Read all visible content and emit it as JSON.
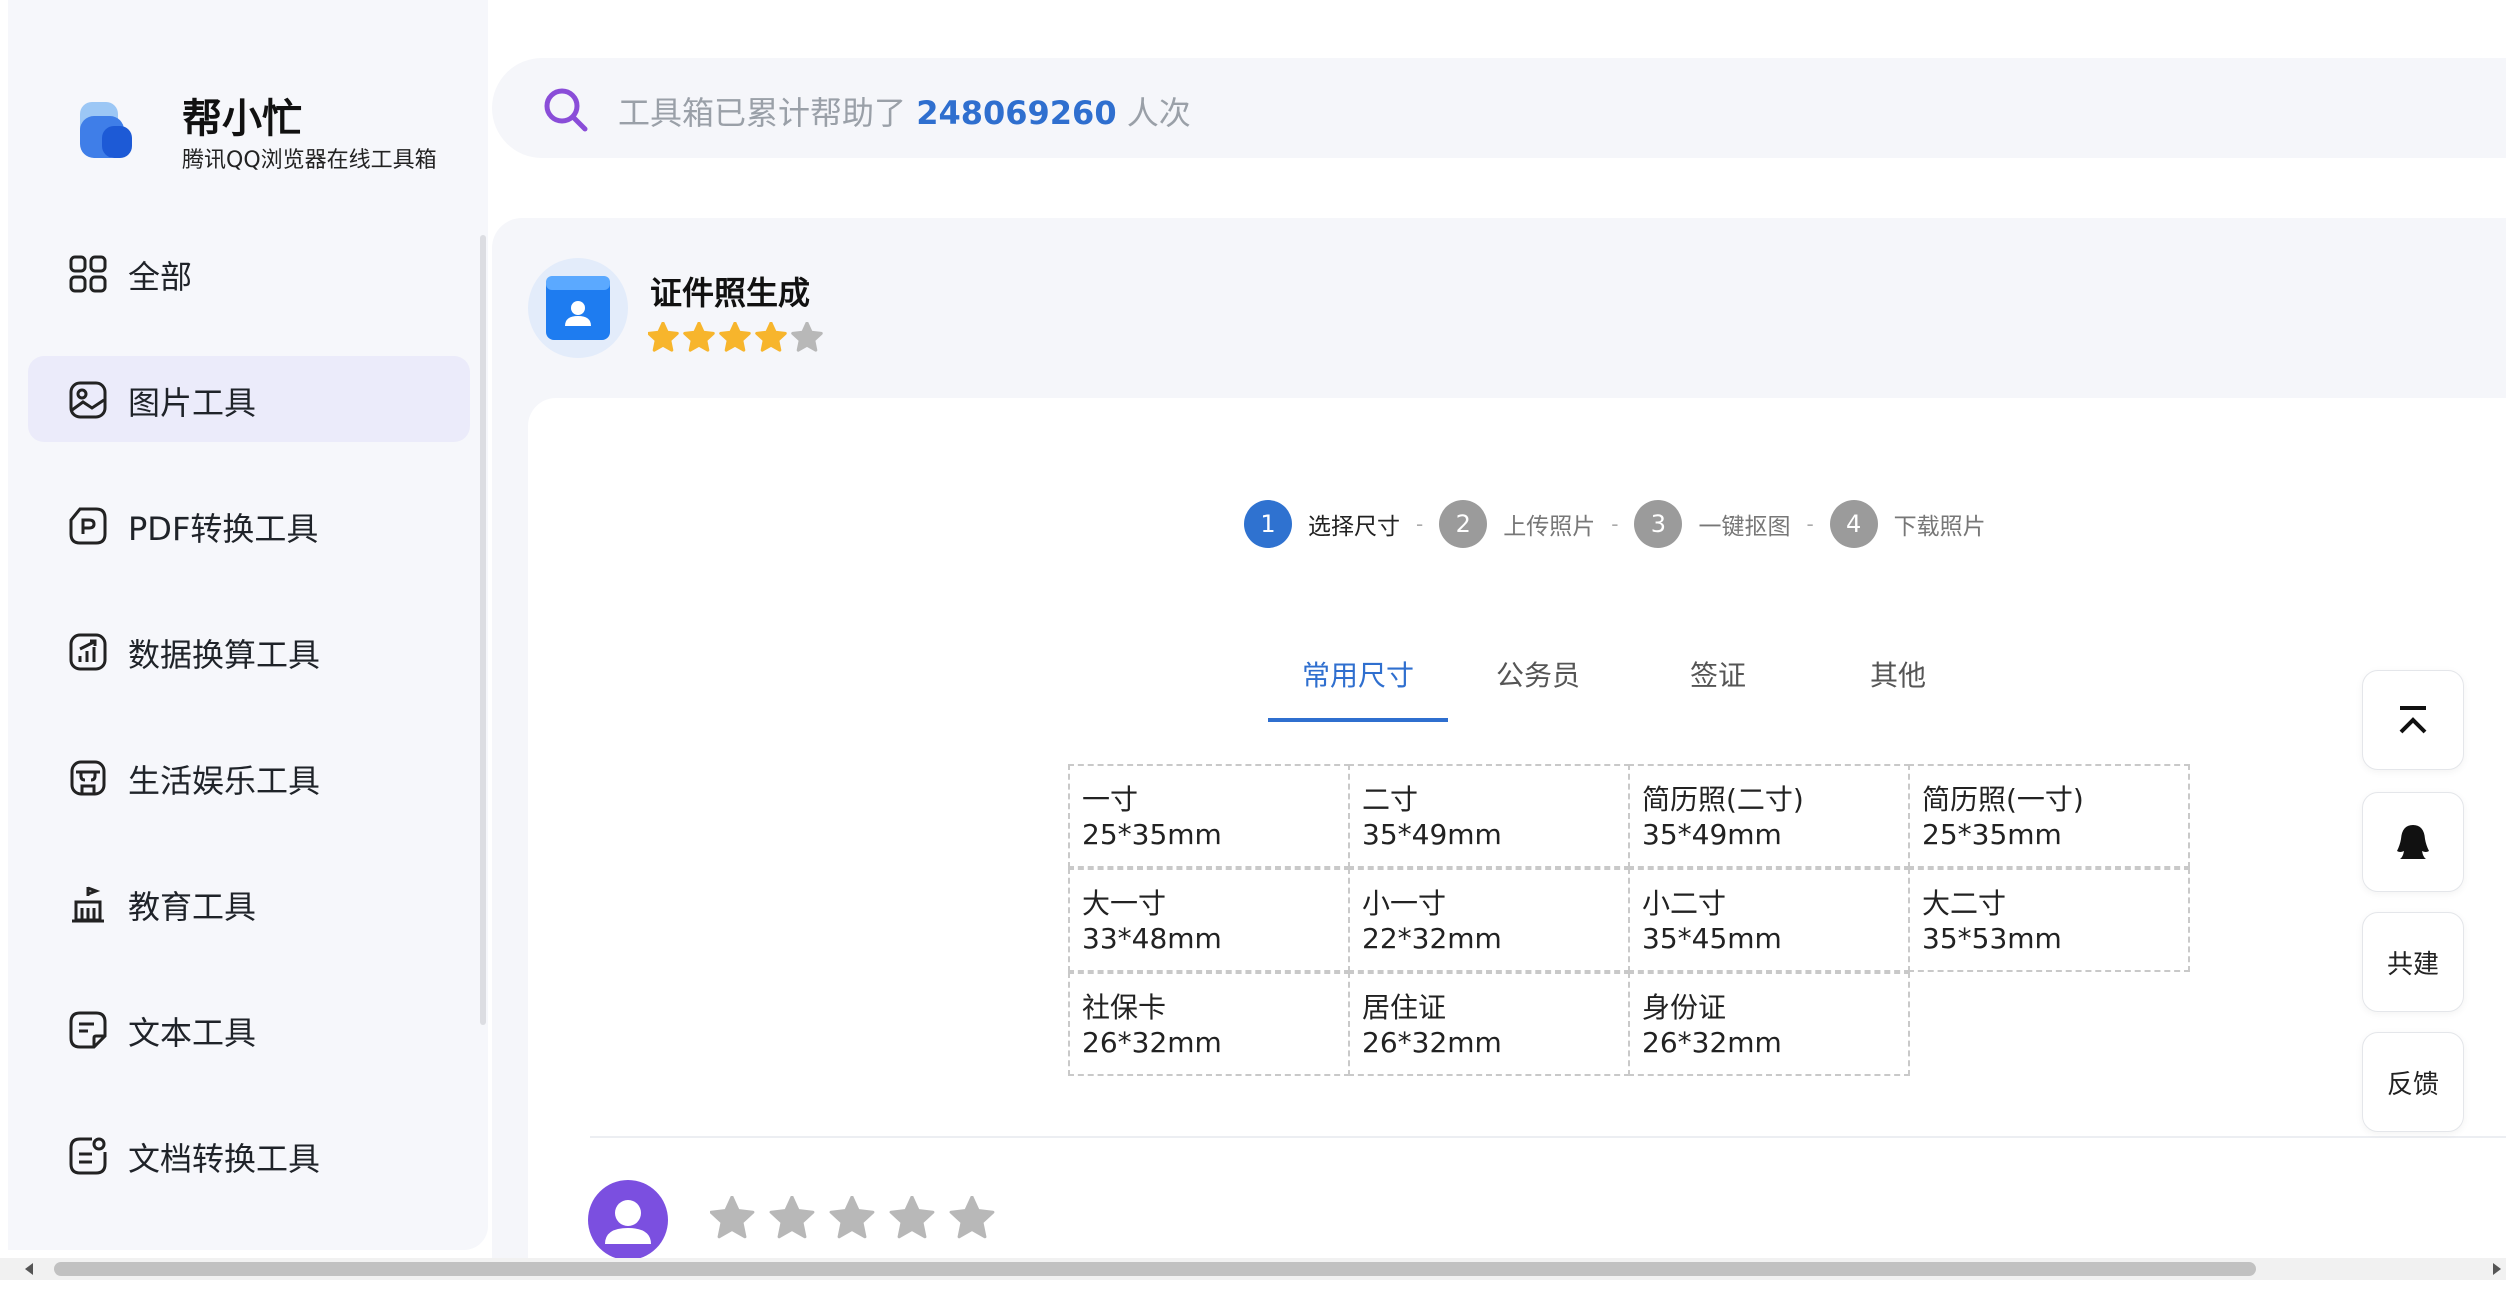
{
  "brand": {
    "name": "帮小忙",
    "subtitle": "腾讯QQ浏览器在线工具箱"
  },
  "sidebar": {
    "items": [
      {
        "label": "全部",
        "icon": "grid-icon",
        "active": false
      },
      {
        "label": "图片工具",
        "icon": "image-icon",
        "active": true
      },
      {
        "label": "PDF转换工具",
        "icon": "pdf-icon",
        "active": false
      },
      {
        "label": "数据换算工具",
        "icon": "chart-icon",
        "active": false
      },
      {
        "label": "生活娱乐工具",
        "icon": "shop-icon",
        "active": false
      },
      {
        "label": "教育工具",
        "icon": "school-icon",
        "active": false
      },
      {
        "label": "文本工具",
        "icon": "text-doc-icon",
        "active": false
      },
      {
        "label": "文档转换工具",
        "icon": "doc-convert-icon",
        "active": false
      }
    ]
  },
  "search": {
    "prefix": "工具箱已累计帮助了",
    "count": "248069260",
    "suffix": "人次"
  },
  "tool": {
    "title": "证件照生成",
    "rating": 4,
    "rating_max": 5
  },
  "steps": [
    {
      "num": "1",
      "label": "选择尺寸",
      "active": true
    },
    {
      "num": "2",
      "label": "上传照片",
      "active": false
    },
    {
      "num": "3",
      "label": "一键抠图",
      "active": false
    },
    {
      "num": "4",
      "label": "下载照片",
      "active": false
    }
  ],
  "tabs": [
    {
      "label": "常用尺寸",
      "active": true
    },
    {
      "label": "公务员",
      "active": false
    },
    {
      "label": "签证",
      "active": false
    },
    {
      "label": "其他",
      "active": false
    }
  ],
  "sizes": [
    {
      "name": "一寸",
      "size": "25*35mm"
    },
    {
      "name": "二寸",
      "size": "35*49mm"
    },
    {
      "name": "简历照(二寸)",
      "size": "35*49mm"
    },
    {
      "name": "简历照(一寸)",
      "size": "25*35mm"
    },
    {
      "name": "大一寸",
      "size": "33*48mm"
    },
    {
      "name": "小一寸",
      "size": "22*32mm"
    },
    {
      "name": "小二寸",
      "size": "35*45mm"
    },
    {
      "name": "大二寸",
      "size": "35*53mm"
    },
    {
      "name": "社保卡",
      "size": "26*32mm"
    },
    {
      "name": "居住证",
      "size": "26*32mm"
    },
    {
      "name": "身份证",
      "size": "26*32mm"
    }
  ],
  "floating": {
    "top_icon": "back-to-top-icon",
    "qq_icon": "qq-penguin-icon",
    "cobuild": "共建",
    "feedback": "反馈"
  },
  "user_rating": {
    "rating": 0,
    "rating_max": 5
  },
  "colors": {
    "accent": "#2f6fcf",
    "active_nav_bg": "#ebebfa",
    "star_on": "#f7b52c",
    "star_off": "#b8b8b8"
  }
}
